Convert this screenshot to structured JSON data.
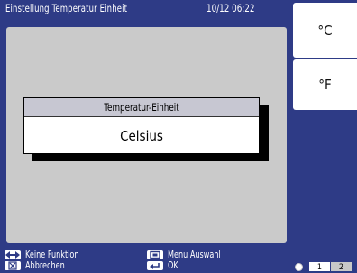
{
  "header": {
    "title": "Einstellung Temperatur Einheit",
    "datetime": "10/12 06:22"
  },
  "dialog": {
    "title": "Temperatur-Einheit",
    "value": "Celsius"
  },
  "unit_buttons": {
    "celsius": "°C",
    "fahrenheit": "°F"
  },
  "hints": {
    "left_right": "Keine Funktion",
    "menu": "Menu Auswahl",
    "cancel": "Abbrechen",
    "ok": "OK"
  },
  "pages": [
    "1",
    "2"
  ],
  "colors": {
    "background": "#2e3b86",
    "work_area": "#cacaca",
    "dialog_header": "#c7c7d2"
  }
}
